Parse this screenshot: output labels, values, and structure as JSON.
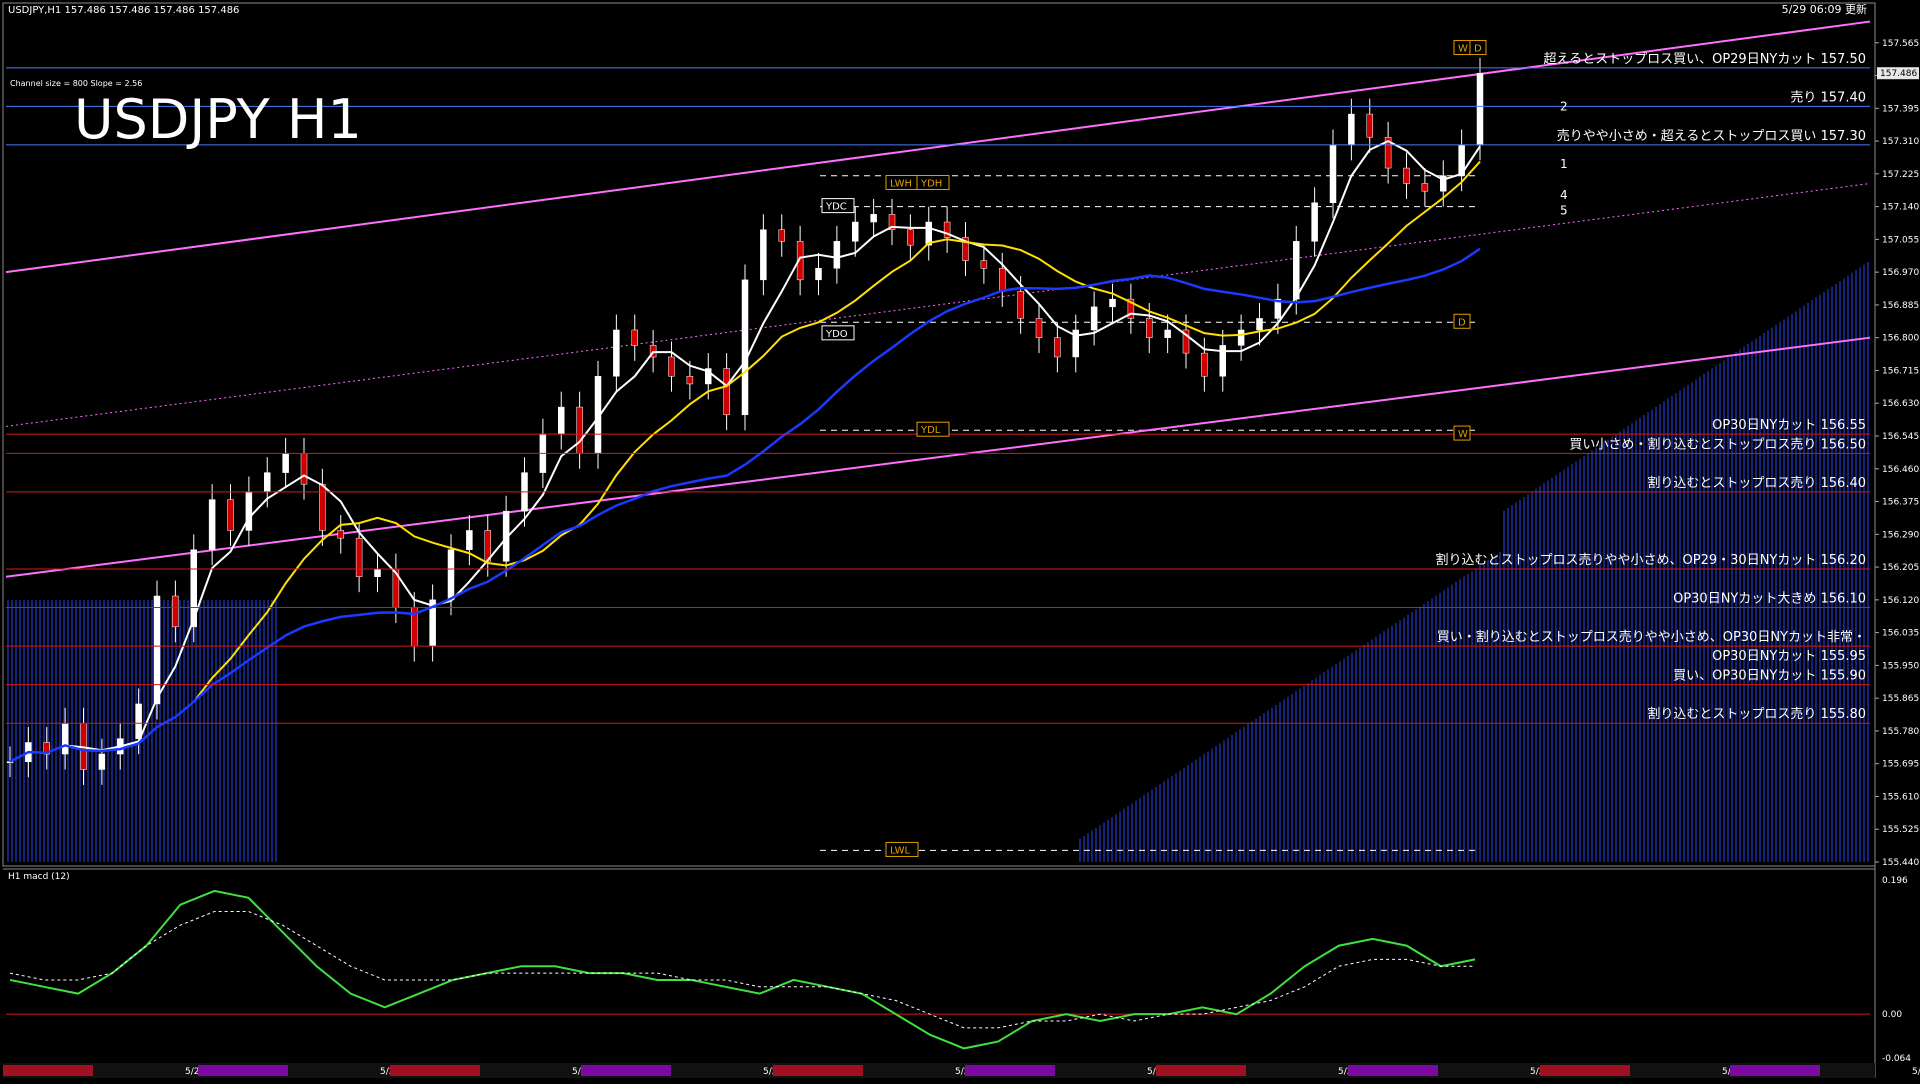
{
  "header": {
    "symbol_info": "USDJPY,H1  157.486 157.486 157.486 157.486",
    "updated": "5/29 06:09 更新",
    "channel_info": "Channel size = 800 Slope = 2.56",
    "big_title": "USDJPY H1",
    "macd_title": "H1  macd (12)"
  },
  "chart_data": [
    {
      "type": "line",
      "title": "USDJPY H1",
      "ylim": [
        155.44,
        157.65
      ],
      "current_price": "157.486",
      "y_ticks": [
        "157.565",
        "157.480",
        "157.395",
        "157.310",
        "157.225",
        "157.140",
        "157.055",
        "156.970",
        "156.885",
        "156.800",
        "156.715",
        "156.630",
        "156.545",
        "156.460",
        "156.375",
        "156.290",
        "156.205",
        "156.120",
        "156.035",
        "155.950",
        "155.865",
        "155.780",
        "155.695",
        "155.610",
        "155.525",
        "155.440"
      ],
      "x_ticks": [
        "5/20",
        "5/21",
        "5/22",
        "5/23",
        "5/24",
        "5/27",
        "5/28",
        "5/29",
        "5/30",
        "5/31"
      ],
      "levels": [
        {
          "label": "超えるとストップロス買い、OP29日NYカット 157.50",
          "value": 157.5,
          "color": "#4a7bff"
        },
        {
          "label": "売り 157.40",
          "value": 157.4,
          "color": "#4a7bff"
        },
        {
          "label": "売りやや小さめ・超えるとストップロス買い 157.30",
          "value": 157.3,
          "color": "#4a7bff"
        },
        {
          "label": "OP30日NYカット 156.55",
          "value": 156.55,
          "color": "#d81818"
        },
        {
          "label": "買い小さめ・割り込むとストップロス売り 156.50",
          "value": 156.5,
          "color": "#d81818"
        },
        {
          "label": "割り込むとストップロス売り 156.40",
          "value": 156.4,
          "color": "#d81818"
        },
        {
          "label": "割り込むとストップロス売りやや小さめ、OP29・30日NYカット 156.20",
          "value": 156.2,
          "color": "#d81818"
        },
        {
          "label": "OP30日NYカット大きめ 156.10",
          "value": 156.1,
          "color": "#d81818"
        },
        {
          "label": "買い・割り込むとストップロス売りやや小さめ、OP30日NYカット非常・",
          "value": 156.0,
          "color": "#d81818",
          "extra": "OP30日NYカット 155.95"
        },
        {
          "label": "買い、OP30日NYカット 155.90",
          "value": 155.9,
          "color": "#d81818"
        },
        {
          "label": "割り込むとストップロス売り 155.80",
          "value": 155.8,
          "color": "#d81818"
        }
      ],
      "markers": [
        {
          "label": "LWH",
          "value": 157.2
        },
        {
          "label": "YDH",
          "value": 157.2
        },
        {
          "label": "YDC",
          "value": 157.14
        },
        {
          "label": "YDO",
          "value": 156.81
        },
        {
          "label": "YDL",
          "value": 156.56
        },
        {
          "label": "LWL",
          "value": 155.47
        },
        {
          "label": "W",
          "value": 157.55
        },
        {
          "label": "D",
          "value": 157.55
        },
        {
          "label": "D",
          "value": 156.84
        },
        {
          "label": "W",
          "value": 156.55
        }
      ],
      "projection_labels": [
        "2",
        "1",
        "4",
        "5"
      ],
      "price_path": [
        155.7,
        155.75,
        155.72,
        155.8,
        155.68,
        155.72,
        155.76,
        155.85,
        156.13,
        156.05,
        156.25,
        156.38,
        156.3,
        156.4,
        156.45,
        156.5,
        156.42,
        156.3,
        156.28,
        156.18,
        156.2,
        156.1,
        156.0,
        156.12,
        156.25,
        156.3,
        156.22,
        156.35,
        156.45,
        156.55,
        156.62,
        156.5,
        156.7,
        156.82,
        156.78,
        156.75,
        156.7,
        156.68,
        156.72,
        156.6,
        156.95,
        157.08,
        157.05,
        156.95,
        156.98,
        157.05,
        157.1,
        157.12,
        157.08,
        157.04,
        157.1,
        157.06,
        157.0,
        156.98,
        156.92,
        156.85,
        156.8,
        156.75,
        156.82,
        156.88,
        156.9,
        156.85,
        156.8,
        156.82,
        156.76,
        156.7,
        156.78,
        156.82,
        156.85,
        156.9,
        157.05,
        157.15,
        157.3,
        157.38,
        157.32,
        157.24,
        157.2,
        157.18,
        157.22,
        157.3,
        157.486
      ]
    },
    {
      "type": "line",
      "title": "H1 macd (12)",
      "ylim": [
        -0.064,
        0.196
      ],
      "y_ticks": [
        "0.196",
        "0.00",
        "-0.064"
      ],
      "macd": [
        0.05,
        0.04,
        0.03,
        0.06,
        0.1,
        0.16,
        0.18,
        0.17,
        0.12,
        0.07,
        0.03,
        0.01,
        0.03,
        0.05,
        0.06,
        0.07,
        0.07,
        0.06,
        0.06,
        0.05,
        0.05,
        0.04,
        0.03,
        0.05,
        0.04,
        0.03,
        0.0,
        -0.03,
        -0.05,
        -0.04,
        -0.01,
        0.0,
        -0.01,
        0.0,
        0.0,
        0.01,
        0.0,
        0.03,
        0.07,
        0.1,
        0.11,
        0.1,
        0.07,
        0.08
      ],
      "signal": [
        0.06,
        0.05,
        0.05,
        0.06,
        0.1,
        0.13,
        0.15,
        0.15,
        0.13,
        0.1,
        0.07,
        0.05,
        0.05,
        0.05,
        0.06,
        0.06,
        0.06,
        0.06,
        0.06,
        0.06,
        0.05,
        0.05,
        0.04,
        0.04,
        0.04,
        0.03,
        0.02,
        0.0,
        -0.02,
        -0.02,
        -0.01,
        -0.01,
        0.0,
        -0.01,
        0.0,
        0.0,
        0.01,
        0.02,
        0.04,
        0.07,
        0.08,
        0.08,
        0.07,
        0.07
      ]
    }
  ]
}
